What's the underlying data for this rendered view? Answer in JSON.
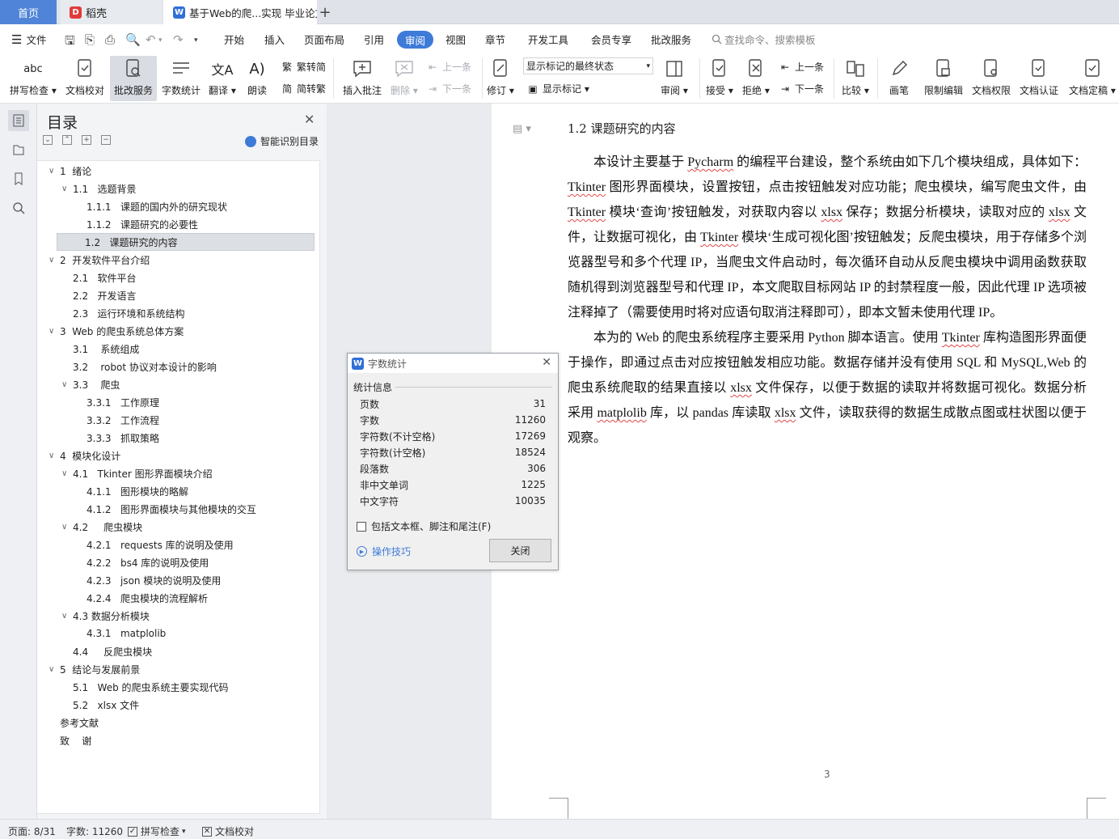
{
  "tabs": {
    "home": "首页",
    "daoke": "稻壳",
    "doc": "基于Web的爬...实现 毕业论文",
    "add": "+"
  },
  "menu": {
    "file": "文件",
    "items": [
      "开始",
      "插入",
      "页面布局",
      "引用",
      "审阅",
      "视图",
      "章节",
      "开发工具",
      "会员专享",
      "批改服务"
    ],
    "active": "审阅",
    "search": "查找命令、搜索模板"
  },
  "ribbon": {
    "spell": "拼写检查",
    "proof": "文档校对",
    "correct": "批改服务",
    "wordcount": "字数统计",
    "translate": "翻译",
    "read": "朗读",
    "to_trad": "繁转简",
    "to_simp": "简转繁",
    "insert_comment": "插入批注",
    "delete": "删除",
    "prev": "上一条",
    "next": "下一条",
    "revise": "修订",
    "markup_state": "显示标记的最终状态",
    "show_markup": "显示标记",
    "review": "审阅",
    "accept": "接受",
    "reject": "拒绝",
    "prev2": "上一条",
    "next2": "下一条",
    "compare": "比较",
    "pen": "画笔",
    "restrict": "限制编辑",
    "perm": "文档权限",
    "cert": "文档认证",
    "finalize": "文档定稿",
    "abc": "abc"
  },
  "toc": {
    "title": "目录",
    "smart": "智能识别目录",
    "items": [
      {
        "text": "1  绪论",
        "level": 0,
        "chev": "∨"
      },
      {
        "text": "1.1   选题背景",
        "level": 1,
        "chev": "∨"
      },
      {
        "text": "1.1.1   课题的国内外的研究现状",
        "level": 2,
        "chev": ""
      },
      {
        "text": "1.1.2   课题研究的必要性",
        "level": 2,
        "chev": ""
      },
      {
        "text": "1.2   课题研究的内容",
        "level": 1,
        "chev": "",
        "selected": true
      },
      {
        "text": "2  开发软件平台介绍",
        "level": 0,
        "chev": "∨"
      },
      {
        "text": "2.1   软件平台",
        "level": 1,
        "chev": ""
      },
      {
        "text": "2.2   开发语言",
        "level": 1,
        "chev": ""
      },
      {
        "text": "2.3   运行环境和系统结构",
        "level": 1,
        "chev": ""
      },
      {
        "text": "3  Web 的爬虫系统总体方案",
        "level": 0,
        "chev": "∨"
      },
      {
        "text": "3.1    系统组成",
        "level": 1,
        "chev": ""
      },
      {
        "text": "3.2    robot 协议对本设计的影响",
        "level": 1,
        "chev": ""
      },
      {
        "text": "3.3    爬虫",
        "level": 1,
        "chev": "∨"
      },
      {
        "text": "3.3.1   工作原理",
        "level": 2,
        "chev": ""
      },
      {
        "text": "3.3.2   工作流程",
        "level": 2,
        "chev": ""
      },
      {
        "text": "3.3.3   抓取策略",
        "level": 2,
        "chev": ""
      },
      {
        "text": "4  模块化设计",
        "level": 0,
        "chev": "∨"
      },
      {
        "text": "4.1   Tkinter 图形界面模块介绍",
        "level": 1,
        "chev": "∨"
      },
      {
        "text": "4.1.1   图形模块的略解",
        "level": 2,
        "chev": ""
      },
      {
        "text": "4.1.2   图形界面模块与其他模块的交互",
        "level": 2,
        "chev": ""
      },
      {
        "text": "4.2     爬虫模块",
        "level": 1,
        "chev": "∨"
      },
      {
        "text": "4.2.1   requests 库的说明及使用",
        "level": 2,
        "chev": ""
      },
      {
        "text": "4.2.2   bs4 库的说明及使用",
        "level": 2,
        "chev": ""
      },
      {
        "text": "4.2.3   json 模块的说明及使用",
        "level": 2,
        "chev": ""
      },
      {
        "text": "4.2.4   爬虫模块的流程解析",
        "level": 2,
        "chev": ""
      },
      {
        "text": "4.3 数据分析模块",
        "level": 1,
        "chev": "∨"
      },
      {
        "text": "4.3.1   matplolib",
        "level": 2,
        "chev": ""
      },
      {
        "text": "4.4     反爬虫模块",
        "level": 1,
        "chev": ""
      },
      {
        "text": "5  结论与发展前景",
        "level": 0,
        "chev": "∨"
      },
      {
        "text": "5.1   Web 的爬虫系统主要实现代码",
        "level": 1,
        "chev": ""
      },
      {
        "text": "5.2   xlsx 文件",
        "level": 1,
        "chev": ""
      },
      {
        "text": "参考文献",
        "level": 0,
        "chev": "",
        "nochev": true
      },
      {
        "text": "致    谢",
        "level": 0,
        "chev": "",
        "nochev": true
      }
    ]
  },
  "document": {
    "heading": "1.2   课题研究的内容",
    "para1": [
      {
        "t": "本设计主要基于 "
      },
      {
        "t": "Pycharm",
        "w": true
      },
      {
        "t": " 的编程平台建设，整个系统由如下几个模块组成，具体如下："
      },
      {
        "t": "Tkinter",
        "w": true
      },
      {
        "t": " 图形界面模块，设置按钮，点击按钮触发对应功能；爬虫模块，编写爬虫文件，由 "
      },
      {
        "t": "Tkinter",
        "w": true
      },
      {
        "t": " 模块‘查询’按钮触发，对获取内容以 "
      },
      {
        "t": "xlsx",
        "w": true
      },
      {
        "t": " 保存；数据分析模块，读取对应的 "
      },
      {
        "t": "xlsx",
        "w": true
      },
      {
        "t": " 文件，让数据可视化，由 "
      },
      {
        "t": "Tkinter",
        "w": true
      },
      {
        "t": " 模块‘生成可视化图’按钮触发；反爬虫模块，用于存储多个浏览器型号和多个代理 IP，当爬虫文件启动时，每次循环自动从反爬虫模块中调用函数获取随机得到浏览器型号和代理 IP，本文爬取目标网站 IP 的封禁程度一般，因此代理 IP 选项被注释掉了（需要使用时将对应语句取消注释即可），即本文暂未使用代理 IP。"
      }
    ],
    "para2": [
      {
        "t": "本为的 Web 的爬虫系统程序主要采用 Python 脚本语言。使用 "
      },
      {
        "t": "Tkinter",
        "w": true
      },
      {
        "t": " 库构造图形界面便于操作，即通过点击对应按钮触发相应功能。数据存储并没有使用 SQL 和 MySQL,Web 的爬虫系统爬取的结果直接以 "
      },
      {
        "t": "xlsx",
        "w": true
      },
      {
        "t": " 文件保存，以便于数据的读取并将数据可视化。数据分析采用 "
      },
      {
        "t": "matplolib",
        "w": true
      },
      {
        "t": " 库，以 pandas 库读取 "
      },
      {
        "t": "xlsx",
        "w": true
      },
      {
        "t": " 文件，读取获得的数据生成散点图或柱状图以便于观察。"
      }
    ],
    "page_number": "3"
  },
  "dialog": {
    "title": "字数统计",
    "section": "统计信息",
    "rows": [
      {
        "label": "页数",
        "value": "31"
      },
      {
        "label": "字数",
        "value": "11260"
      },
      {
        "label": "字符数(不计空格)",
        "value": "17269"
      },
      {
        "label": "字符数(计空格)",
        "value": "18524"
      },
      {
        "label": "段落数",
        "value": "306"
      },
      {
        "label": "非中文单词",
        "value": "1225"
      },
      {
        "label": "中文字符",
        "value": "10035"
      }
    ],
    "checkbox": "包括文本框、脚注和尾注(F)",
    "tips": "操作技巧",
    "close": "关闭"
  },
  "status": {
    "page": "页面: 8/31",
    "words": "字数: 11260",
    "spell": "拼写检查",
    "proof": "文档校对"
  },
  "colors": {
    "accent": "#3e7bd8",
    "wavy": "#e04848",
    "wps": "#2f6fd6",
    "daoke": "#e23a3a"
  }
}
